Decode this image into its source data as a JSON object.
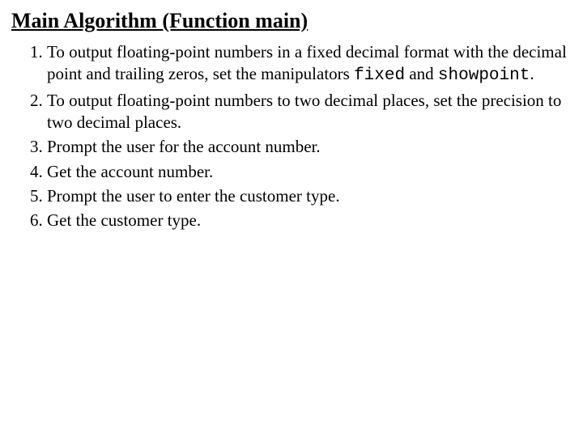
{
  "title": "Main Algorithm (Function main)",
  "items": {
    "i1a": "To output floating-point numbers in a fixed decimal format with the decimal point and trailing zeros, set the manipulators ",
    "i1_kw1": "fixed",
    "i1b": " and ",
    "i1_kw2": "showpoint",
    "i1c": ".",
    "i2": "To output floating-point numbers to two decimal places, set the precision to two decimal places.",
    "i3": "Prompt the user for the account number.",
    "i4": "Get the account number.",
    "i5": "Prompt the user to enter the customer type.",
    "i6": "Get the customer type."
  }
}
